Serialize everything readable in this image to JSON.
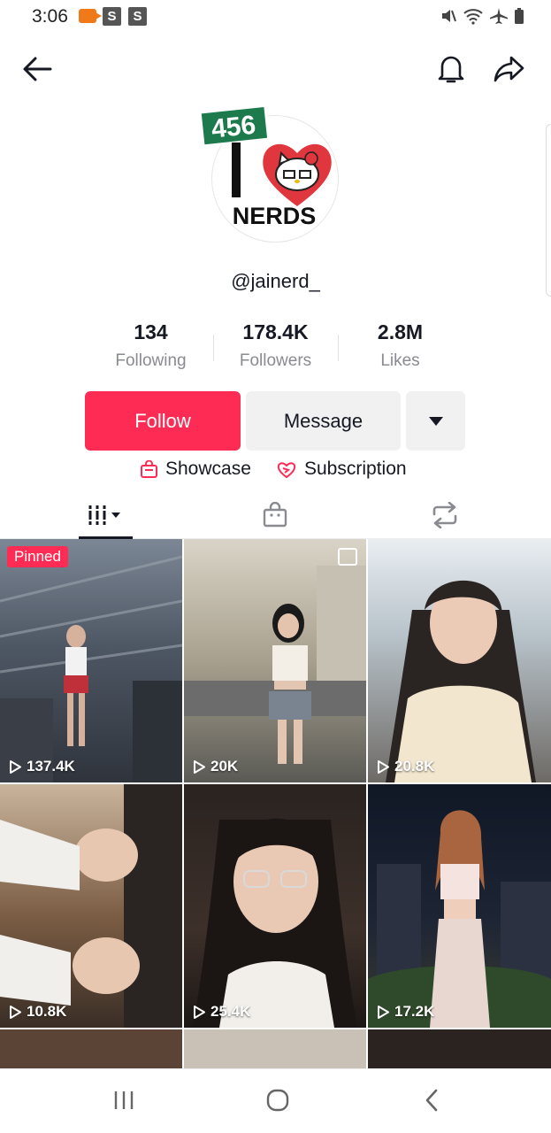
{
  "status_bar": {
    "time": "3:06",
    "badge_1": "S",
    "badge_2": "S"
  },
  "profile": {
    "avatar_sign_number": "456",
    "avatar_text": "NERDS",
    "username": "@jainerd_"
  },
  "stats": {
    "following": {
      "value": "134",
      "label": "Following"
    },
    "followers": {
      "value": "178.4K",
      "label": "Followers"
    },
    "likes": {
      "value": "2.8M",
      "label": "Likes"
    }
  },
  "actions": {
    "follow_label": "Follow",
    "message_label": "Message"
  },
  "links": {
    "showcase": "Showcase",
    "subscription": "Subscription"
  },
  "colors": {
    "accent": "#fe2c55",
    "text": "#161823",
    "muted": "#8a8b91"
  },
  "videos": [
    {
      "views": "137.4K",
      "pinned_label": "Pinned"
    },
    {
      "views": "20K"
    },
    {
      "views": "20.8K"
    },
    {
      "views": "10.8K"
    },
    {
      "views": "25.4K"
    },
    {
      "views": "17.2K"
    }
  ]
}
